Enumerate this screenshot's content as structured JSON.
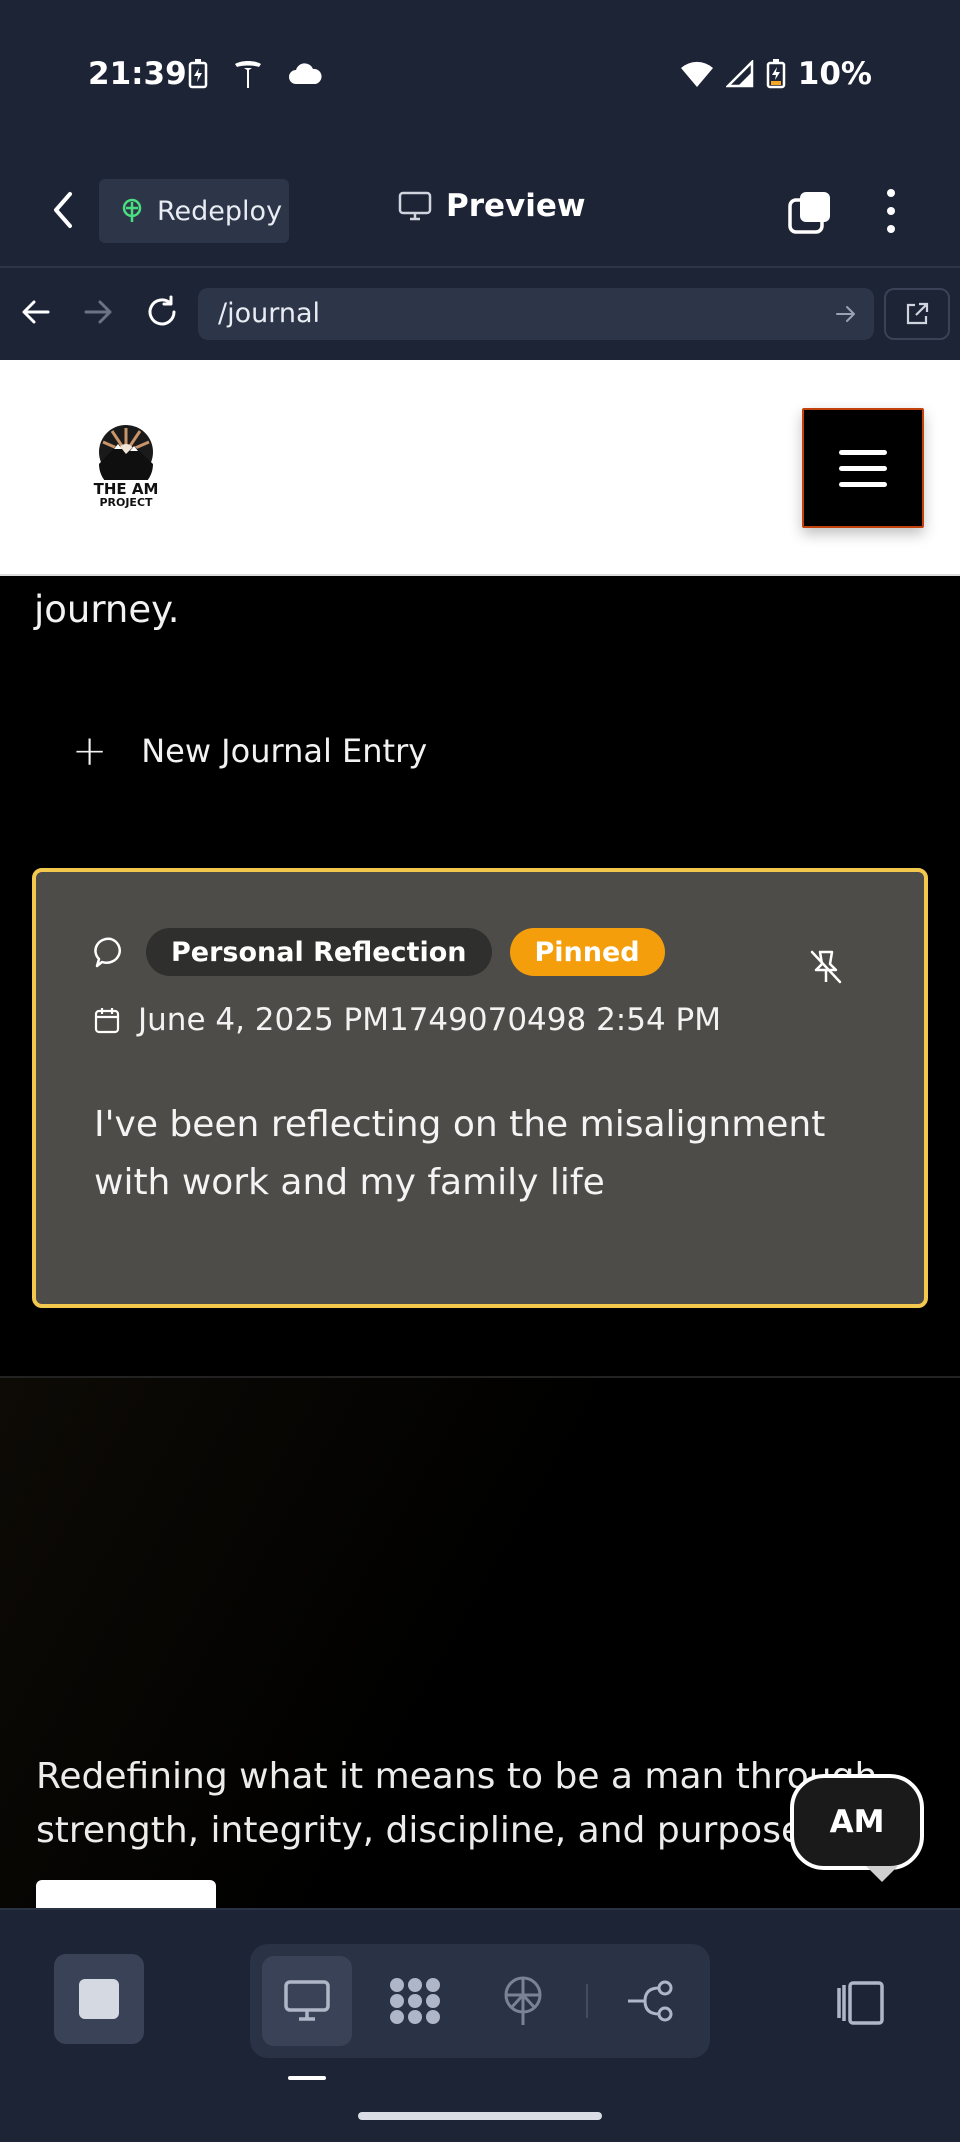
{
  "status_bar": {
    "time": "21:39",
    "battery": "10%",
    "icons_left": [
      "battery-charging-icon",
      "tesla-icon",
      "cloud-icon"
    ],
    "icons_right": [
      "wifi-icon",
      "cell-signal-icon",
      "battery-icon"
    ]
  },
  "toolbar": {
    "redeploy_label": "Redeploy",
    "preview_label": "Preview"
  },
  "browser": {
    "url": "/journal"
  },
  "site": {
    "logo_line1": "THE AM",
    "logo_line2": "PROJECT",
    "intro_tail": "journey.",
    "new_entry_label": "New Journal Entry"
  },
  "entry": {
    "category": "Personal Reflection",
    "pinned_label": "Pinned",
    "date": "June 4, 2025 PM1749070498 2:54 PM",
    "body": "I've been reflecting on the misalignment with work and my family life"
  },
  "footer": {
    "tagline": "Redefining what it means to be a man through strength, integrity, discipline, and purpose."
  },
  "chat": {
    "avatar_label": "AM"
  },
  "colors": {
    "app_bg": "#1d2436",
    "surface": "#2d3548",
    "card_bg": "#4d4c48",
    "card_border": "#f2c94c",
    "pinned_badge": "#f59e0b",
    "menu_border": "#c2410c"
  }
}
